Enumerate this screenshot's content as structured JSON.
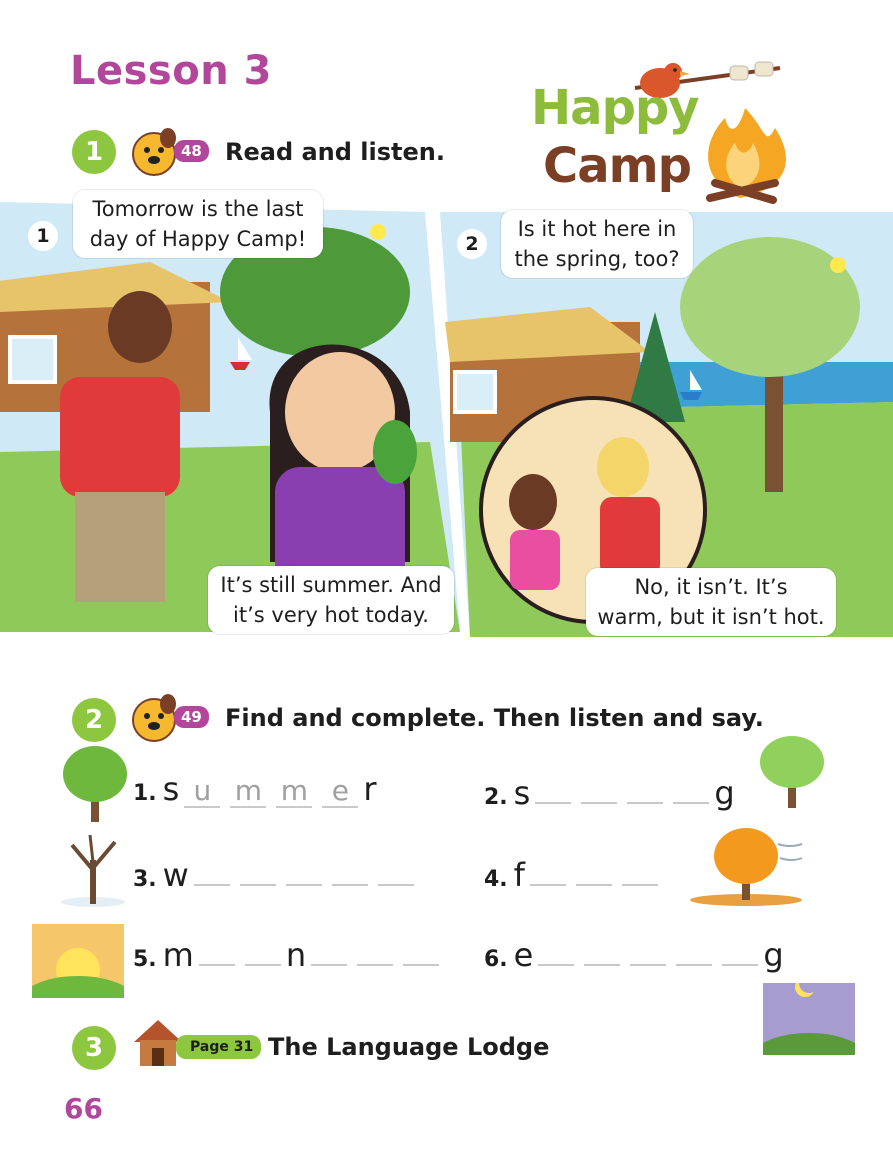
{
  "lesson": {
    "title": "Lesson 3"
  },
  "logo": {
    "line1": "Happy",
    "line2": "Camp"
  },
  "activity1": {
    "number": "1",
    "track": "48",
    "instruction": "Read and listen.",
    "panels": [
      {
        "number": "1",
        "bubbles": [
          "Tomorrow is the last\nday of Happy Camp!",
          "It’s still summer. And\nit’s very hot today."
        ]
      },
      {
        "number": "2",
        "bubbles": [
          "Is it hot here in\nthe spring, too?",
          "No, it isn’t. It’s\nwarm, but it isn’t hot."
        ]
      }
    ]
  },
  "activity2": {
    "number": "2",
    "track": "49",
    "instruction": "Find and complete. Then listen and say.",
    "items": [
      {
        "num": "1.",
        "start": "s",
        "filled": [
          "u",
          "m",
          "m",
          "e"
        ],
        "end": "r",
        "icon": "summer-tree-icon"
      },
      {
        "num": "2.",
        "start": "s",
        "blanks": 4,
        "end": "g",
        "icon": "spring-tree-icon"
      },
      {
        "num": "3.",
        "start": "w",
        "blanks": 5,
        "icon": "winter-tree-icon"
      },
      {
        "num": "4.",
        "start": "f",
        "blanks": 3,
        "icon": "fall-tree-icon"
      },
      {
        "num": "5.",
        "start": "m",
        "blanks_a": 2,
        "middle": "n",
        "blanks_b": 3,
        "icon": "sunrise-icon"
      },
      {
        "num": "6.",
        "start": "e",
        "blanks": 5,
        "end": "g",
        "icon": "moon-night-icon"
      }
    ]
  },
  "activity3": {
    "number": "3",
    "page_ref": "Page 31",
    "title": "The Language Lodge"
  },
  "footer": {
    "page_number": "66"
  },
  "colors": {
    "purple": "#b2469a",
    "green": "#8dc63f",
    "brown": "#7a3f25"
  }
}
